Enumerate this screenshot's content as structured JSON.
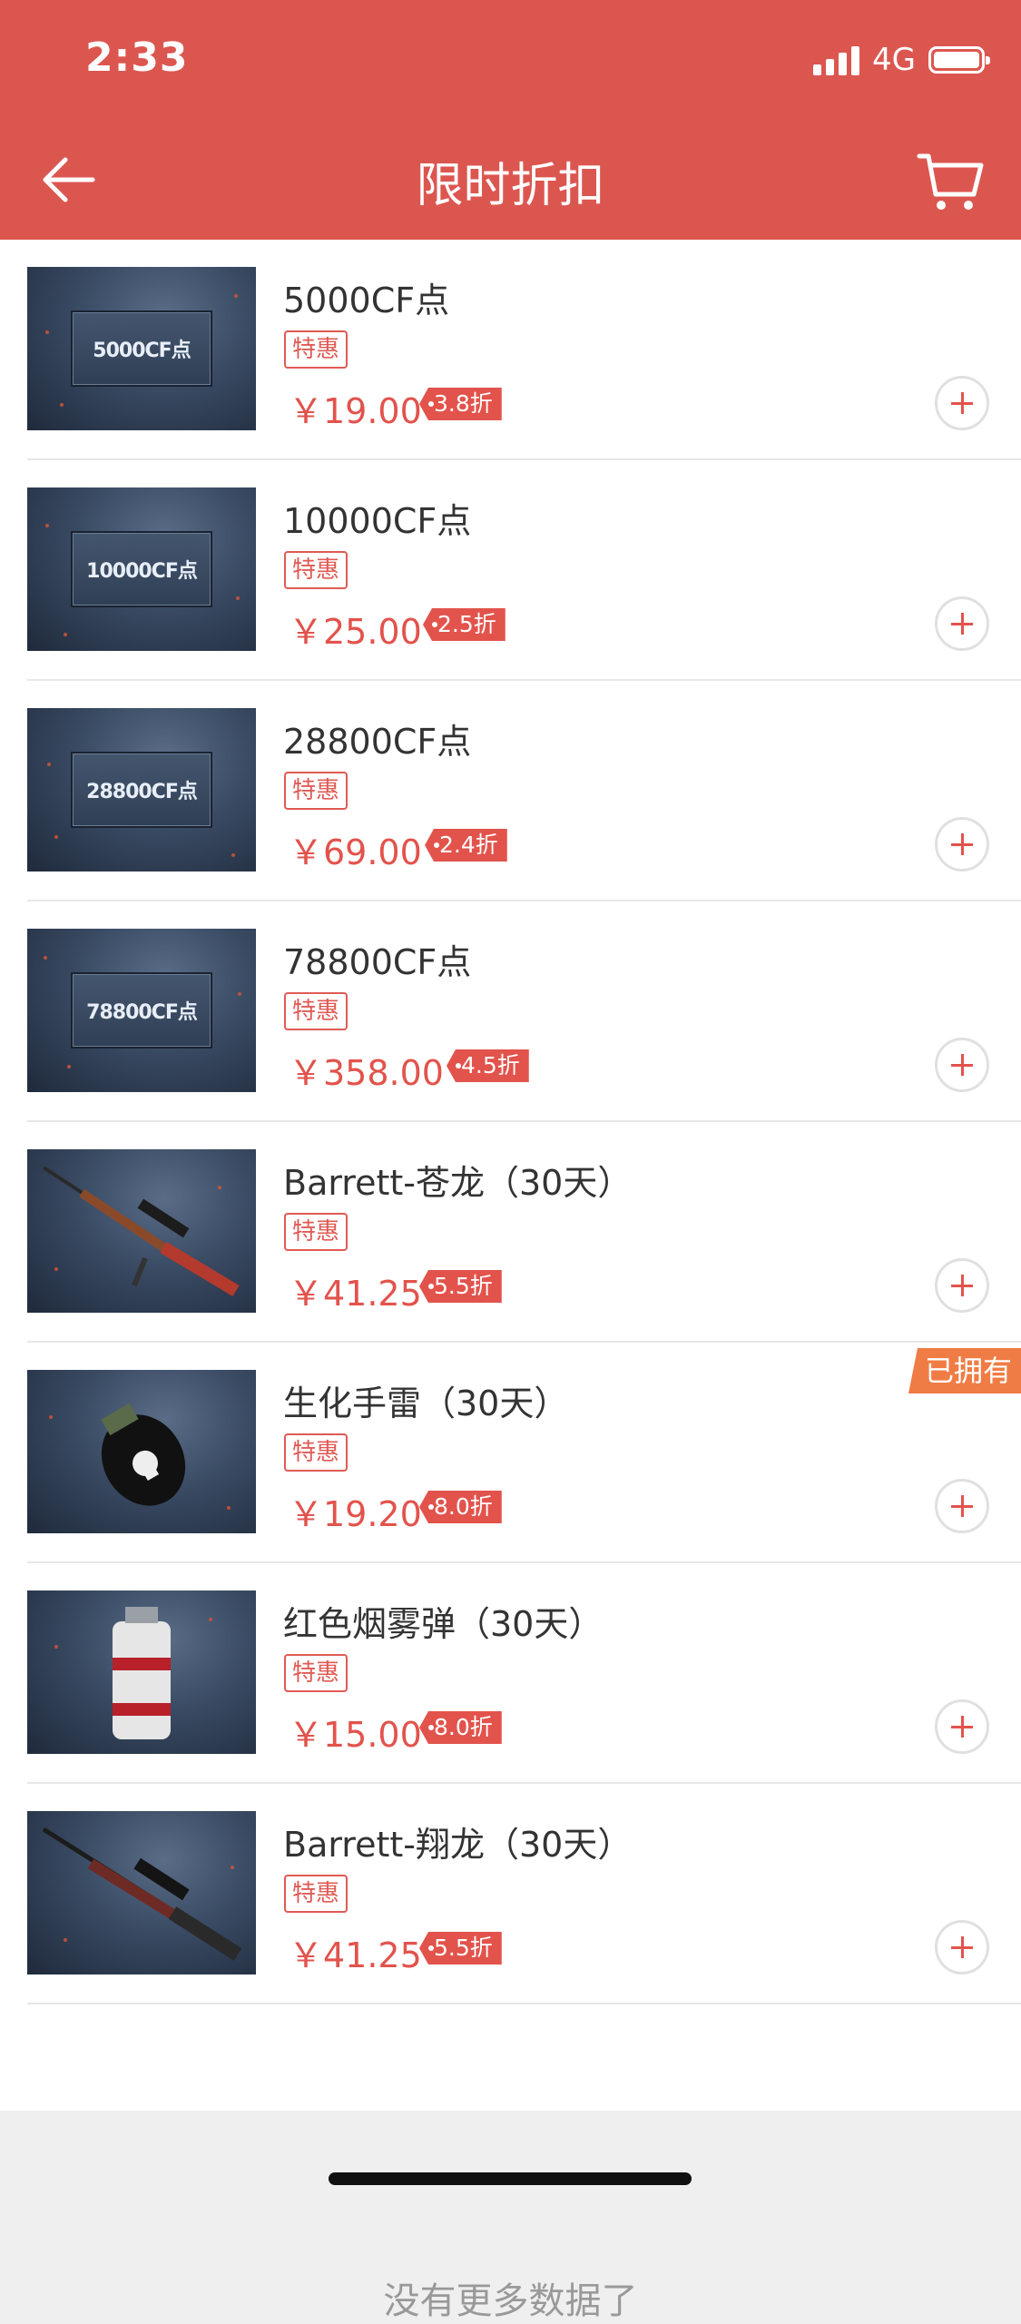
{
  "status_bar": {
    "time": "2:33",
    "network": "4G"
  },
  "header": {
    "title": "限时折扣"
  },
  "items": [
    {
      "name": "5000CF点",
      "tag": "特惠",
      "price": "￥19.00",
      "discount": "3.8折",
      "thumb_label": "5000CF点",
      "owned": false
    },
    {
      "name": "10000CF点",
      "tag": "特惠",
      "price": "￥25.00",
      "discount": "2.5折",
      "thumb_label": "10000CF点",
      "owned": false
    },
    {
      "name": "28800CF点",
      "tag": "特惠",
      "price": "￥69.00",
      "discount": "2.4折",
      "thumb_label": "28800CF点",
      "owned": false
    },
    {
      "name": "78800CF点",
      "tag": "特惠",
      "price": "￥358.00",
      "discount": "4.5折",
      "thumb_label": "78800CF点",
      "owned": false
    },
    {
      "name": "Barrett-苍龙（30天）",
      "tag": "特惠",
      "price": "￥41.25",
      "discount": "5.5折",
      "owned": false
    },
    {
      "name": "生化手雷（30天）",
      "tag": "特惠",
      "price": "￥19.20",
      "discount": "8.0折",
      "owned": true,
      "owned_label": "已拥有"
    },
    {
      "name": "红色烟雾弹（30天）",
      "tag": "特惠",
      "price": "￥15.00",
      "discount": "8.0折",
      "owned": false
    },
    {
      "name": "Barrett-翔龙（30天）",
      "tag": "特惠",
      "price": "￥41.25",
      "discount": "5.5折",
      "owned": false
    }
  ],
  "footer": {
    "text": "没有更多数据了"
  },
  "colors": {
    "header_bg": "#dc5650",
    "accent": "#e2534c",
    "owned_badge": "#f07c45"
  },
  "icons": {
    "back": "arrow-left-icon",
    "cart": "cart-icon",
    "add": "plus-icon"
  }
}
